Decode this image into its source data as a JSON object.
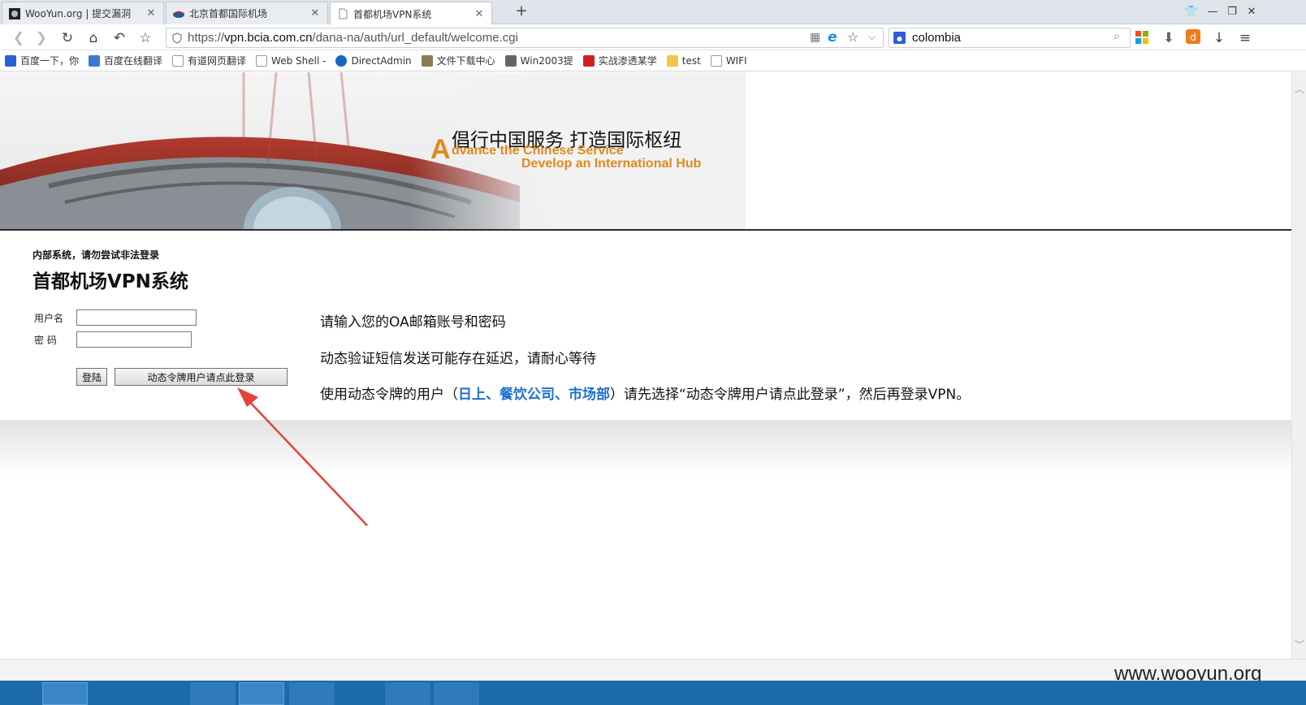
{
  "browser": {
    "tabs": [
      {
        "label": "WooYun.org | 提交漏洞",
        "active": false
      },
      {
        "label": "北京首都国际机场",
        "active": false
      },
      {
        "label": "首都机场VPN系统",
        "active": true
      }
    ],
    "new_tab_label": "+",
    "url_prefix": "https://",
    "url_domain": "vpn.bcia.com.cn",
    "url_path": "/dana-na/auth/url_default/welcome.cgi",
    "search_value": "colombia",
    "bookmarks": [
      "百度一下，你",
      "百度在线翻译",
      "有道网页翻译",
      "Web Shell -",
      "DirectAdmin",
      "文件下载中心",
      "Win2003提",
      "实战渗透某学",
      "test",
      "WIFI"
    ]
  },
  "banner": {
    "slogan_cn": "倡行中国服务 打造国际枢纽",
    "slogan_en_cap": "A",
    "slogan_en_line1": "dvance the Chinese Service",
    "slogan_en_line2": "Develop an International Hub"
  },
  "login": {
    "warning": "内部系统，请勿尝试非法登录",
    "title": "首都机场VPN系统",
    "username_label": "用户名",
    "password_label": "密 码",
    "username_value": "",
    "password_value": "",
    "login_button": "登陆",
    "token_button": "动态令牌用户请点此登录"
  },
  "info": {
    "line1": "请输入您的OA邮箱账号和密码",
    "line2": "动态验证短信发送可能存在延迟，请耐心等待",
    "line3_a": "使用动态令牌的用户（",
    "line3_highlight": "日上、餐饮公司、市场部",
    "line3_b": "）请先选择“动态令牌用户请点此登录”，然后再登录VPN。"
  },
  "watermark": "www.wooyun.org",
  "colors": {
    "accent_blue": "#1d6fd1",
    "arrow_red": "#e8403a",
    "slogan_orange": "#e08a1e",
    "taskbar": "#1c6aa8"
  }
}
